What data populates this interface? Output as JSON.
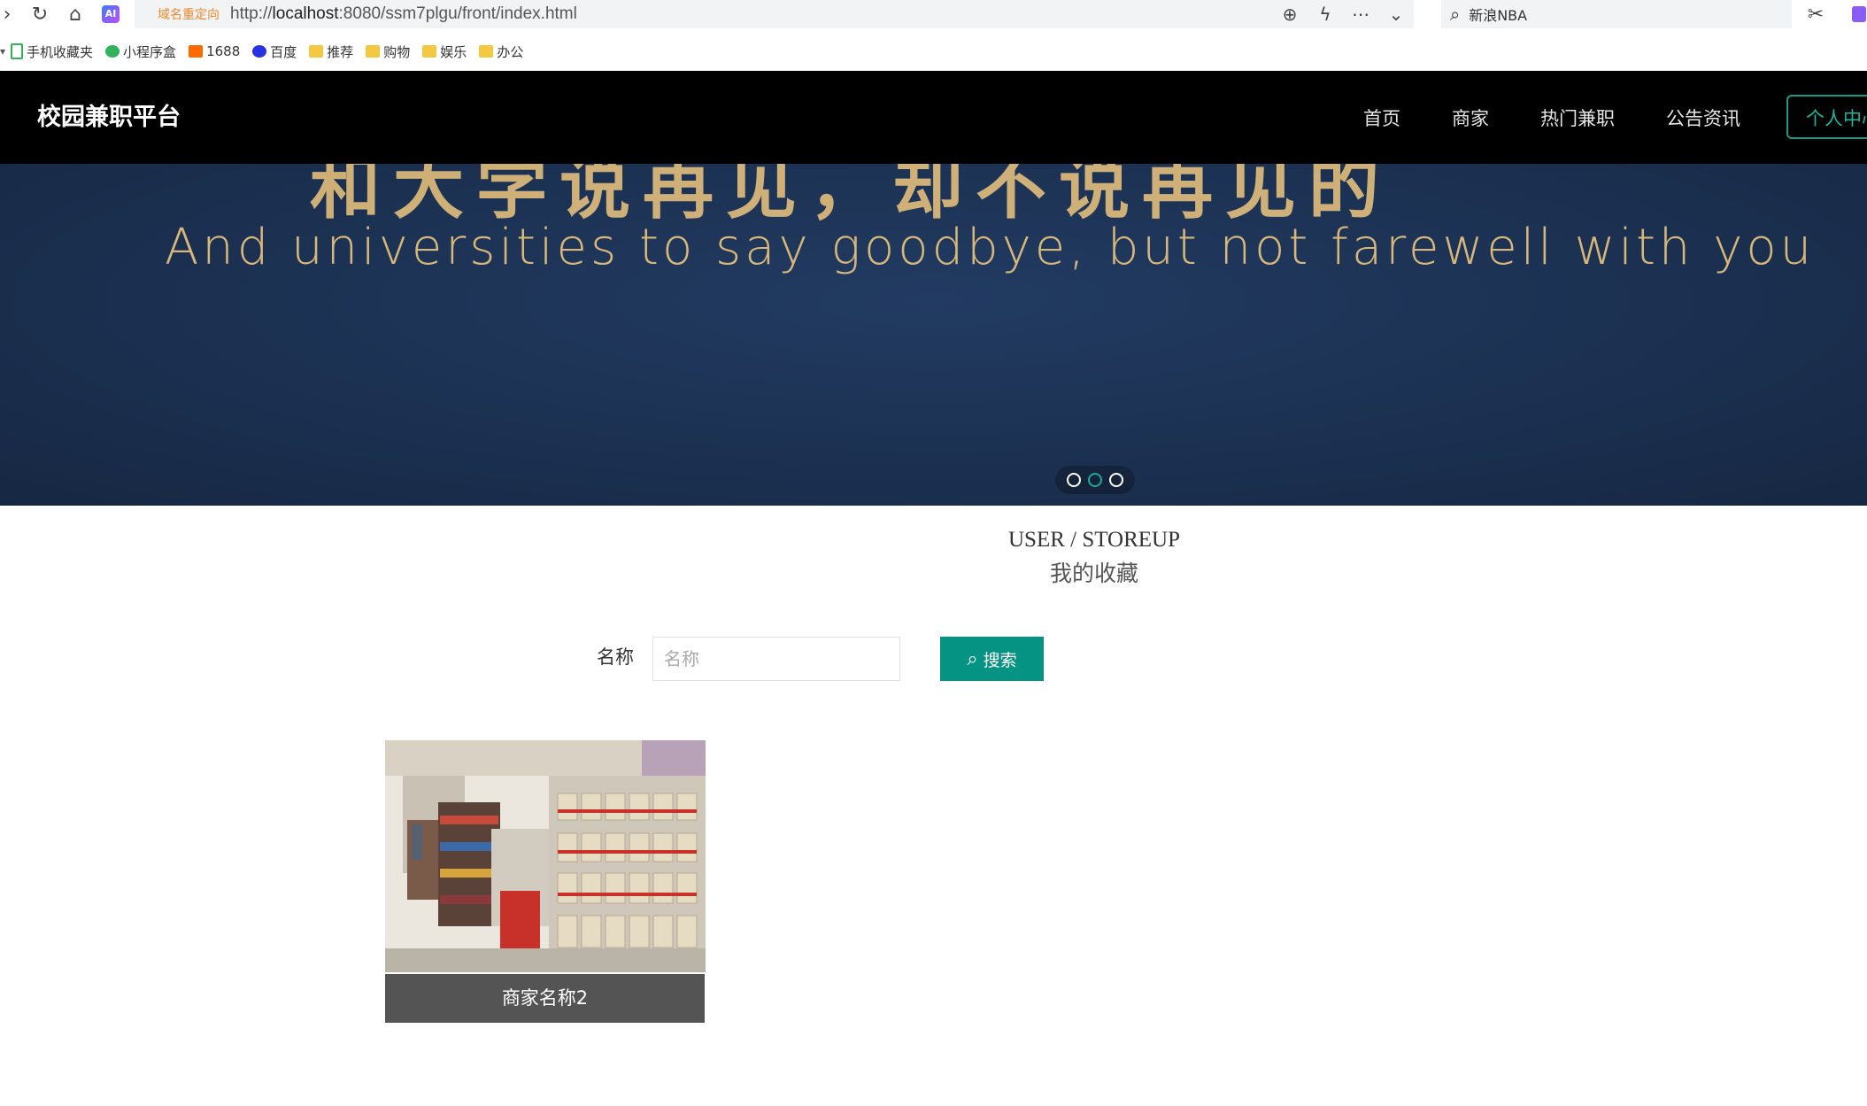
{
  "browser": {
    "redirect_tag": "域名重定向",
    "url_prefix": "http://",
    "url_host": "localhost",
    "url_rest": ":8080/ssm7plgu/front/index.html",
    "search_placeholder": "新浪NBA",
    "bookmarks": [
      {
        "label": "手机收藏夹",
        "icon": "phone-icon"
      },
      {
        "label": "小程序盒",
        "icon": "miniapp-icon"
      },
      {
        "label": "1688",
        "icon": "1688-icon"
      },
      {
        "label": "百度",
        "icon": "baidu-paw-icon"
      },
      {
        "label": "推荐",
        "icon": "folder-icon"
      },
      {
        "label": "购物",
        "icon": "folder-icon"
      },
      {
        "label": "娱乐",
        "icon": "folder-icon"
      },
      {
        "label": "办公",
        "icon": "folder-icon"
      }
    ]
  },
  "site": {
    "brand": "校园兼职平台",
    "nav": [
      "首页",
      "商家",
      "热门兼职",
      "公告资讯"
    ],
    "nav_button": "个人中心"
  },
  "banner": {
    "english_line": "And universities to say goodbye, but not farewell with you",
    "top_line": "和大学说再见，却不说再见的"
  },
  "section": {
    "title_en": "USER / STOREUP",
    "title_cn": "我的收藏"
  },
  "search": {
    "label": "名称",
    "placeholder": "名称",
    "button": "搜索"
  },
  "cards": [
    {
      "name": "商家名称2"
    }
  ],
  "colors": {
    "accent": "#059383",
    "nav_bg": "#000000",
    "caption_bg": "#545454"
  }
}
